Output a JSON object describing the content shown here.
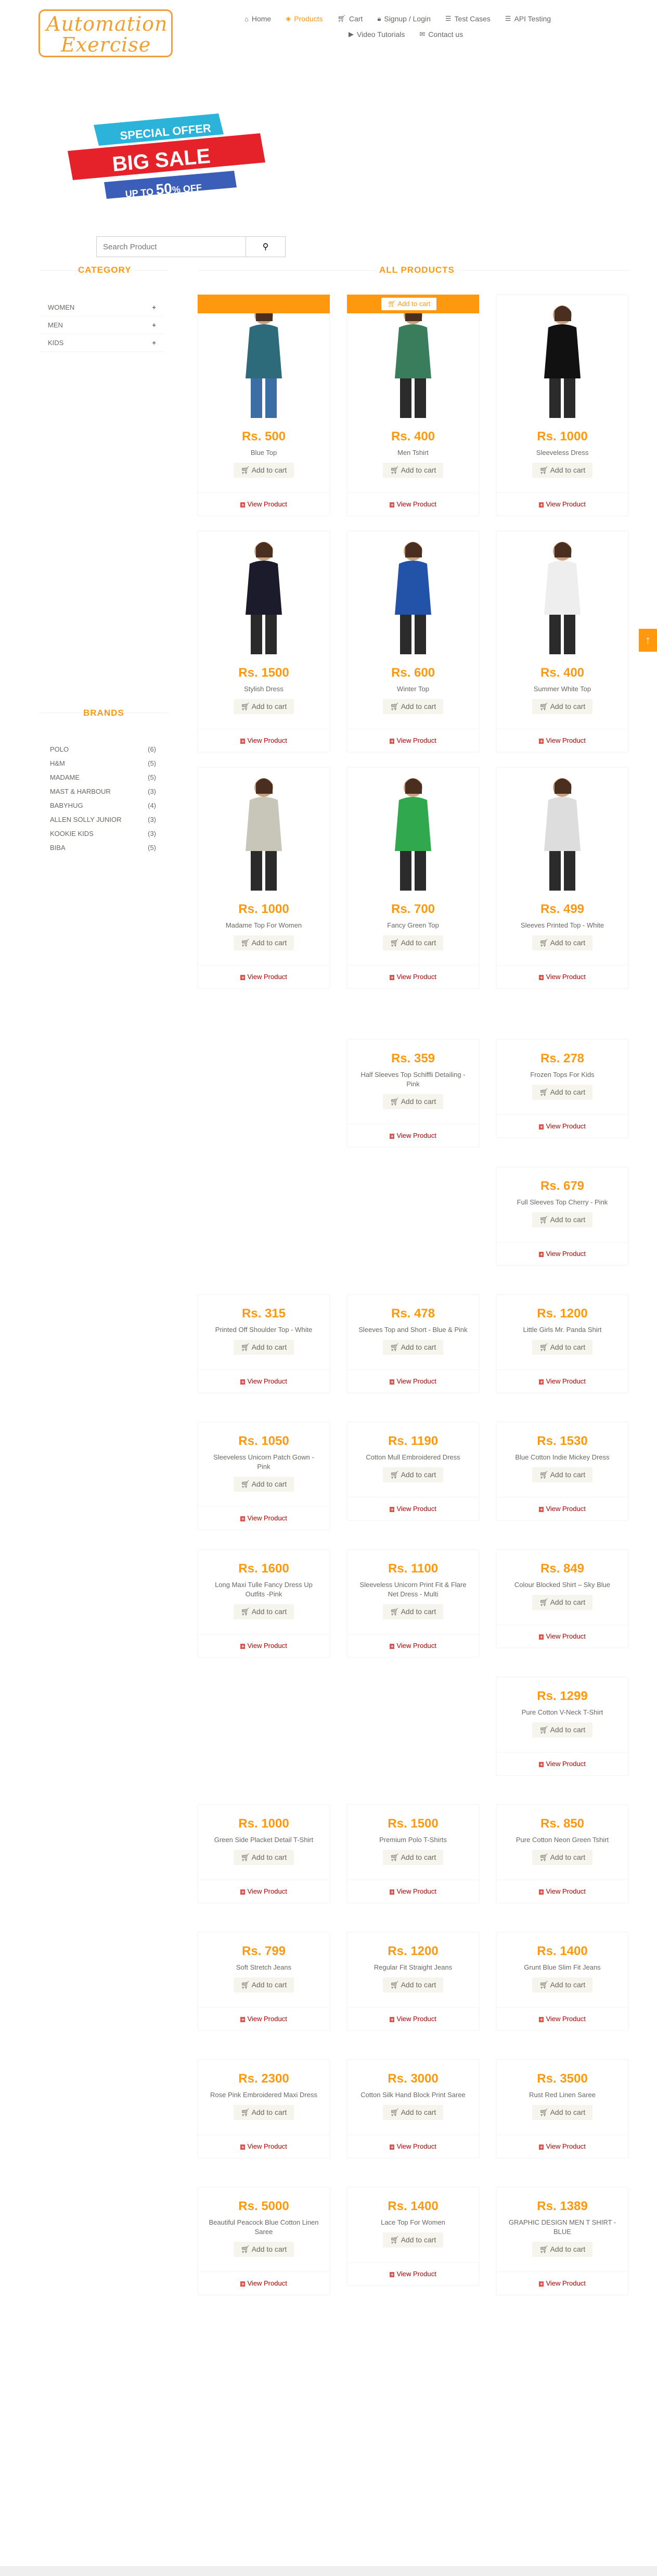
{
  "header": {
    "logo_line1": "Automation",
    "logo_line2": "Exercise",
    "nav": [
      {
        "label": "Home",
        "icon": "home-icon"
      },
      {
        "label": "Products",
        "icon": "products-icon"
      },
      {
        "label": "Cart",
        "icon": "cart-icon"
      },
      {
        "label": "Signup / Login",
        "icon": "lock-icon"
      },
      {
        "label": "Test Cases",
        "icon": "list-icon"
      },
      {
        "label": "API Testing",
        "icon": "list-icon"
      },
      {
        "label": "Video Tutorials",
        "icon": "youtube-icon"
      },
      {
        "label": "Contact us",
        "icon": "envelope-icon"
      }
    ]
  },
  "banner": {
    "line1": "SPECIAL OFFER",
    "line2": "BIG SALE",
    "line3a": "UP",
    "line3b": "TO",
    "line3c": "50",
    "line3d": "%",
    "line3e": "OFF"
  },
  "search": {
    "placeholder": "Search Product"
  },
  "sidebar": {
    "category_title": "CATEGORY",
    "categories": [
      {
        "label": "WOMEN"
      },
      {
        "label": "MEN"
      },
      {
        "label": "KIDS"
      }
    ],
    "brands_title": "BRANDS",
    "brands": [
      {
        "label": "POLO",
        "count": "(6)"
      },
      {
        "label": "H&M",
        "count": "(5)"
      },
      {
        "label": "MADAME",
        "count": "(5)"
      },
      {
        "label": "MAST & HARBOUR",
        "count": "(3)"
      },
      {
        "label": "BABYHUG",
        "count": "(4)"
      },
      {
        "label": "ALLEN SOLLY JUNIOR",
        "count": "(3)"
      },
      {
        "label": "KOOKIE KIDS",
        "count": "(3)"
      },
      {
        "label": "BIBA",
        "count": "(5)"
      }
    ]
  },
  "main": {
    "title": "ALL PRODUCTS",
    "add_to_cart": "Add to cart",
    "view_product": "View Product",
    "products": [
      {
        "price": "Rs. 500",
        "name": "Blue Top"
      },
      {
        "price": "Rs. 400",
        "name": "Men Tshirt"
      },
      {
        "price": "Rs. 1000",
        "name": "Sleeveless Dress"
      },
      {
        "price": "Rs. 1500",
        "name": "Stylish Dress"
      },
      {
        "price": "Rs. 600",
        "name": "Winter Top"
      },
      {
        "price": "Rs. 400",
        "name": "Summer White Top"
      },
      {
        "price": "Rs. 1000",
        "name": "Madame Top For Women"
      },
      {
        "price": "Rs. 700",
        "name": "Fancy Green Top"
      },
      {
        "price": "Rs. 499",
        "name": "Sleeves Printed Top - White"
      },
      {
        "price": "Rs. 359",
        "name": "Half Sleeves Top Schiffli Detailing - Pink"
      },
      {
        "price": "Rs. 278",
        "name": "Frozen Tops For Kids"
      },
      {
        "price": "Rs. 679",
        "name": "Full Sleeves Top Cherry - Pink"
      },
      {
        "price": "Rs. 315",
        "name": "Printed Off Shoulder Top - White"
      },
      {
        "price": "Rs. 478",
        "name": "Sleeves Top and Short - Blue & Pink"
      },
      {
        "price": "Rs. 1200",
        "name": "Little Girls Mr. Panda Shirt"
      },
      {
        "price": "Rs. 1050",
        "name": "Sleeveless Unicorn Patch Gown - Pink"
      },
      {
        "price": "Rs. 1190",
        "name": "Cotton Mull Embroidered Dress"
      },
      {
        "price": "Rs. 1530",
        "name": "Blue Cotton Indie Mickey Dress"
      },
      {
        "price": "Rs. 1600",
        "name": "Long Maxi Tulle Fancy Dress Up Outfits -Pink"
      },
      {
        "price": "Rs. 1100",
        "name": "Sleeveless Unicorn Print Fit & Flare Net Dress - Multi"
      },
      {
        "price": "Rs. 849",
        "name": "Colour Blocked Shirt – Sky Blue"
      },
      {
        "price": "Rs. 1299",
        "name": "Pure Cotton V-Neck T-Shirt"
      },
      {
        "price": "Rs. 1000",
        "name": "Green Side Placket Detail T-Shirt"
      },
      {
        "price": "Rs. 1500",
        "name": "Premium Polo T-Shirts"
      },
      {
        "price": "Rs. 850",
        "name": "Pure Cotton Neon Green Tshirt"
      },
      {
        "price": "Rs. 799",
        "name": "Soft Stretch Jeans"
      },
      {
        "price": "Rs. 1200",
        "name": "Regular Fit Straight Jeans"
      },
      {
        "price": "Rs. 1400",
        "name": "Grunt Blue Slim Fit Jeans"
      },
      {
        "price": "Rs. 2300",
        "name": "Rose Pink Embroidered Maxi Dress"
      },
      {
        "price": "Rs. 3000",
        "name": "Cotton Silk Hand Block Print Saree"
      },
      {
        "price": "Rs. 3500",
        "name": "Rust Red Linen Saree"
      },
      {
        "price": "Rs. 5000",
        "name": "Beautiful Peacock Blue Cotton Linen Saree"
      },
      {
        "price": "Rs. 1400",
        "name": "Lace Top For Women"
      },
      {
        "price": "Rs. 1389",
        "name": "GRAPHIC DESIGN MEN T SHIRT - BLUE"
      }
    ]
  },
  "colors": {
    "accent": "#fe980f",
    "view_link": "#b30000"
  }
}
